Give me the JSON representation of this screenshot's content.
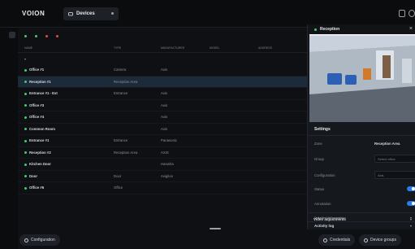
{
  "header": {
    "logo": "VOION",
    "tab_label": "Devices"
  },
  "filters": [
    {
      "label": "",
      "color": "#3ecf6a"
    },
    {
      "label": "",
      "color": "#3ecf6a"
    },
    {
      "label": "",
      "color": "#e5484d"
    },
    {
      "label": "",
      "color": "#e5484d"
    }
  ],
  "table": {
    "columns": [
      "NAME",
      "TYPE",
      "MANUFACTURER",
      "MODEL",
      "ADDRESS"
    ],
    "group_label": "",
    "rows": [
      {
        "name": "Office #1",
        "type": "Camera",
        "manufacturer": "Axis",
        "model": "",
        "address": "",
        "selected": false
      },
      {
        "name": "Reception #1",
        "type": "Reception Area",
        "manufacturer": "",
        "model": "",
        "address": "",
        "selected": true
      },
      {
        "name": "Entrance #1 - Ext",
        "type": "Entrance",
        "manufacturer": "Axis",
        "model": "",
        "address": "",
        "selected": false
      },
      {
        "name": "Office #3",
        "type": "",
        "manufacturer": "Axis",
        "model": "",
        "address": "",
        "selected": false
      },
      {
        "name": "Office #4",
        "type": "",
        "manufacturer": "Axis",
        "model": "",
        "address": "",
        "selected": false
      },
      {
        "name": "Common Room",
        "type": "",
        "manufacturer": "Axis",
        "model": "",
        "address": "",
        "selected": false
      },
      {
        "name": "Entrance #1",
        "type": "Entrance",
        "manufacturer": "Panasonic",
        "model": "",
        "address": "",
        "selected": false
      },
      {
        "name": "Reception #2",
        "type": "Reception Area",
        "manufacturer": "AXIS",
        "model": "",
        "address": "",
        "selected": false
      },
      {
        "name": "Kitchen Door",
        "type": "",
        "manufacturer": "Hanwha",
        "model": "",
        "address": "",
        "selected": false
      },
      {
        "name": "Door",
        "type": "Door",
        "manufacturer": "Avigilon",
        "model": "",
        "address": "",
        "selected": false
      },
      {
        "name": "Office #6",
        "type": "Office",
        "manufacturer": "",
        "model": "",
        "address": "",
        "selected": false
      }
    ]
  },
  "bottom": {
    "left_button": "Configuration",
    "right_button_1": "Credentials",
    "right_button_2": "Device groups"
  },
  "panel": {
    "title": "Reception",
    "settings_title": "Settings",
    "rows": [
      {
        "label": "Zone",
        "value": "Reception Area"
      },
      {
        "label": "Group",
        "select": "Select office"
      },
      {
        "label": "Configuration",
        "select": "Axis"
      }
    ],
    "toggles": [
      {
        "label": "Status",
        "on": true
      },
      {
        "label": "Annotation",
        "on": true
      }
    ],
    "accordions": [
      "Detailed information",
      "Activity log",
      "Video adjustments"
    ]
  },
  "colors": {
    "accent": "#2d7bea",
    "online": "#3ecf6a",
    "selected_row": "#1d2a3a"
  }
}
